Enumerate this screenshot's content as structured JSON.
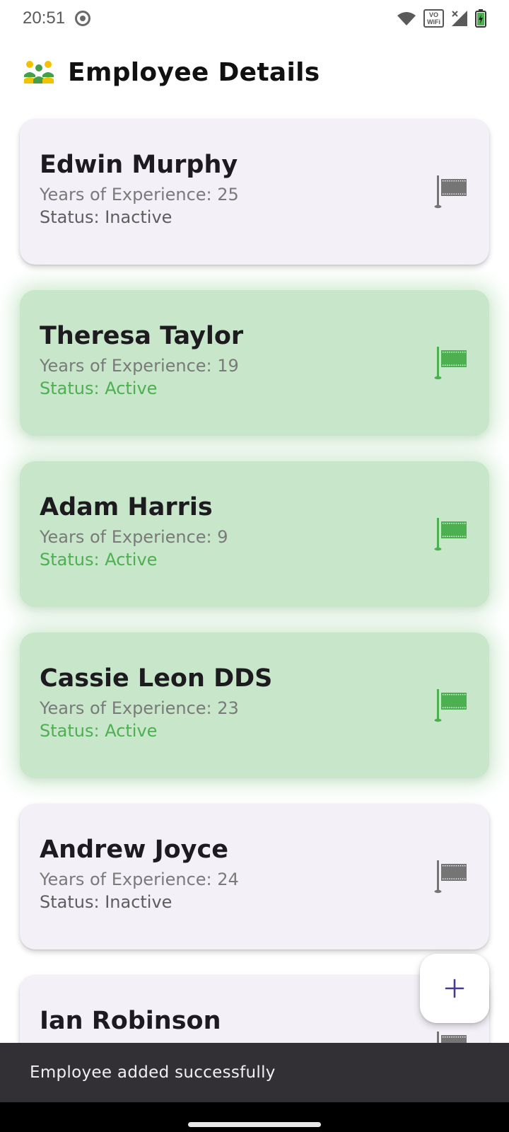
{
  "status_bar": {
    "time": "20:51",
    "vowifi_top": "VO",
    "vowifi_bottom": "WiFi"
  },
  "app_bar": {
    "title": "Employee Details",
    "icon": "group-icon"
  },
  "employees": [
    {
      "name": "Edwin Murphy",
      "experience": "Years of Experience: 25",
      "status": "Status: Inactive",
      "active": false
    },
    {
      "name": "Theresa Taylor",
      "experience": "Years of Experience: 19",
      "status": "Status: Active",
      "active": true
    },
    {
      "name": "Adam Harris",
      "experience": "Years of Experience: 9",
      "status": "Status: Active",
      "active": true
    },
    {
      "name": "Cassie Leon DDS",
      "experience": "Years of Experience: 23",
      "status": "Status: Active",
      "active": true
    },
    {
      "name": "Andrew Joyce",
      "experience": "Years of Experience: 24",
      "status": "Status: Inactive",
      "active": false
    },
    {
      "name": "Ian Robinson",
      "experience": "",
      "status": "",
      "active": false
    }
  ],
  "fab": {
    "icon": "plus-icon"
  },
  "snackbar": {
    "message": "Employee added successfully"
  },
  "colors": {
    "active_card": "#c8e6c9",
    "inactive_card": "#f4f0f8",
    "active_status": "#4caf50",
    "inactive_flag": "#757575",
    "active_flag": "#4caf50",
    "fab_icon": "#4a3a8c",
    "snackbar_bg": "#322f35"
  }
}
